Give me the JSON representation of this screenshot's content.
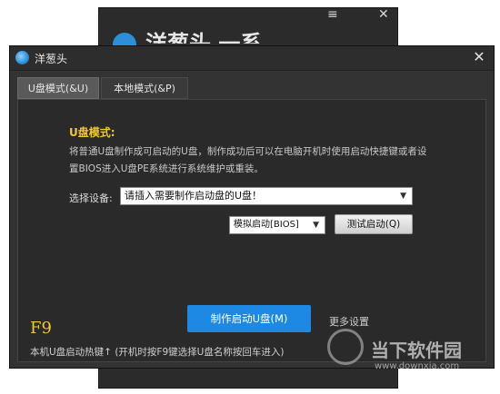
{
  "background_window": {
    "title": "洋葱头 一系禁",
    "menu_icon": "≡",
    "close_icon": "✕"
  },
  "dialog": {
    "title": "洋葱头",
    "close_icon": "✕"
  },
  "tabs": [
    {
      "label": "U盘模式(&U)",
      "active": true
    },
    {
      "label": "本地模式(&P)",
      "active": false
    }
  ],
  "usb_mode": {
    "section_title": "U盘模式:",
    "description": "将普通U盘制作成可启动的U盘，制作成功后可以在电脑开机时使用启动快捷键或者设置BIOS进入U盘PE系统进行系统维护或重装。",
    "device_label": "选择设备:",
    "device_select_value": "请插入需要制作启动盘的U盘！",
    "boot_mode_value": "模拟启动[BIOS]",
    "test_button": "测试启动(Q)",
    "make_button": "制作启动U盘(M)",
    "more_settings": "更多设置"
  },
  "footer": {
    "hotkey": "F9",
    "hint": "本机U盘启动热键↑ (开机时按F9键选择U盘名称按回车进入)"
  },
  "watermark": {
    "text": "当下软件园",
    "url": "www.downxia.com"
  },
  "colors": {
    "accent_yellow": "#f2c832",
    "primary_blue": "#1e88e5",
    "dialog_bg": "#333333",
    "panel_bg": "#2a2a2a"
  }
}
